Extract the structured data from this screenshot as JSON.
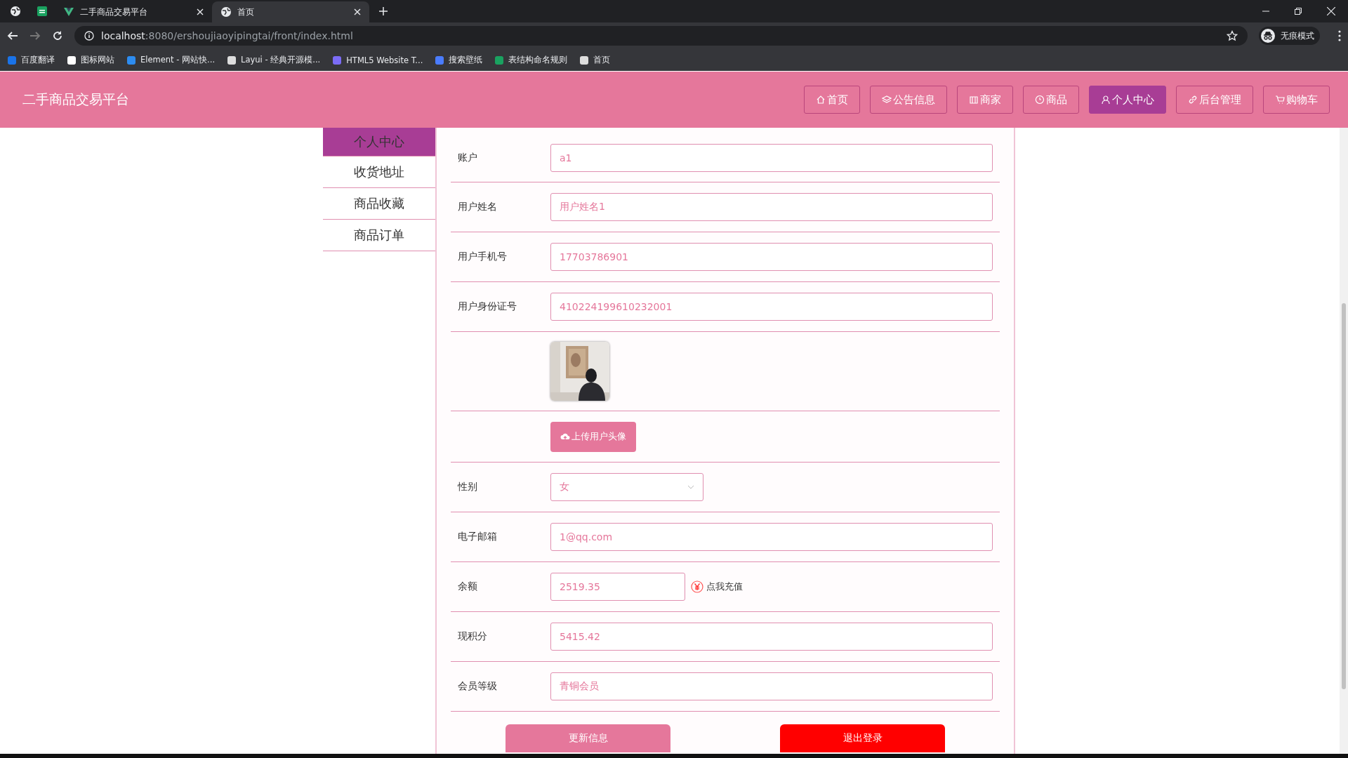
{
  "browser": {
    "tabs": [
      {
        "title": "二手商品交易平台",
        "selected": false
      },
      {
        "title": "首页",
        "selected": true
      }
    ],
    "url_host": "localhost",
    "url_path": ":8080/ershoujiaoyipingtai/front/index.html",
    "profile": "无痕模式",
    "bookmarks": [
      "百度翻译",
      "图标网站",
      "Element - 网站快...",
      "Layui - 经典开源模...",
      "HTML5 Website T...",
      "搜索壁纸",
      "表结构命名规则",
      "首页"
    ]
  },
  "header": {
    "title": "二手商品交易平台",
    "nav": [
      {
        "label": "首页",
        "selected": false
      },
      {
        "label": "公告信息",
        "selected": false
      },
      {
        "label": "商家",
        "selected": false
      },
      {
        "label": "商品",
        "selected": false
      },
      {
        "label": "个人中心",
        "selected": true
      },
      {
        "label": "后台管理",
        "selected": false
      },
      {
        "label": "购物车",
        "selected": false
      }
    ]
  },
  "sidebar": [
    {
      "label": "个人中心",
      "selected": true
    },
    {
      "label": "收货地址",
      "selected": false
    },
    {
      "label": "商品收藏",
      "selected": false
    },
    {
      "label": "商品订单",
      "selected": false
    }
  ],
  "form": [
    {
      "kind": "input",
      "label": "账户",
      "value": "a1"
    },
    {
      "kind": "input",
      "label": "用户姓名",
      "value": "用户姓名1"
    },
    {
      "kind": "input",
      "label": "用户手机号",
      "value": "17703786901"
    },
    {
      "kind": "input",
      "label": "用户身份证号",
      "value": "410224199610232001"
    },
    {
      "kind": "avatar"
    },
    {
      "kind": "upload",
      "button": "上传用户头像"
    },
    {
      "kind": "select",
      "label": "性别",
      "value": "女"
    },
    {
      "kind": "input",
      "label": "电子邮箱",
      "value": "1@qq.com"
    },
    {
      "kind": "balance",
      "label": "余额",
      "value": "2519.35",
      "link": "点我充值"
    },
    {
      "kind": "input",
      "label": "现积分",
      "value": "5415.42"
    },
    {
      "kind": "input",
      "label": "会员等级",
      "value": "青铜会员"
    }
  ],
  "actions": [
    {
      "kind": "primary",
      "label": "更新信息"
    },
    {
      "kind": "danger",
      "label": "退出登录"
    }
  ]
}
